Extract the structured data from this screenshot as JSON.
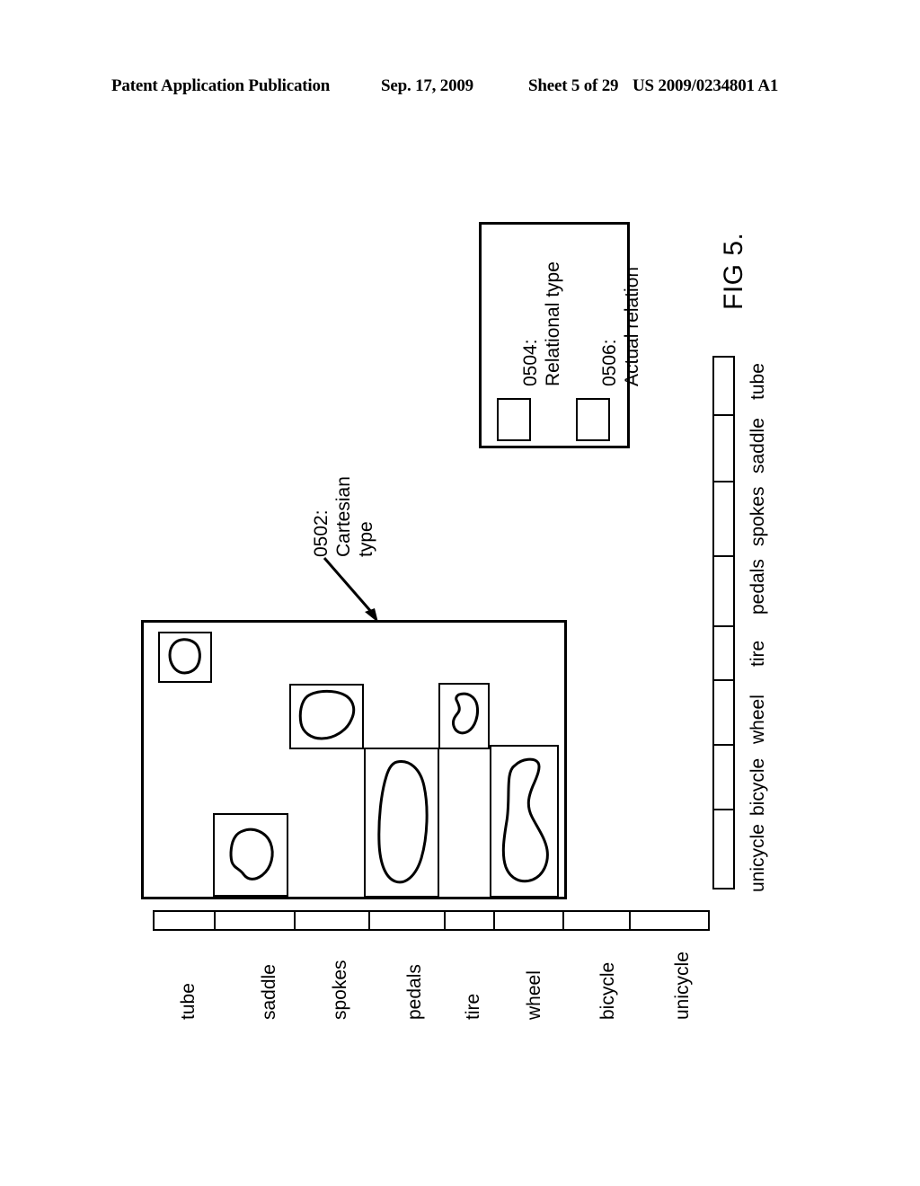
{
  "header": {
    "publication": "Patent Application Publication",
    "date": "Sep. 17, 2009",
    "sheet": "Sheet 5 of 29",
    "number": "US 2009/0234801 A1"
  },
  "figure": {
    "caption": "FIG 5.",
    "annotation_0502": {
      "ref": "0502:",
      "line1": "Cartesian",
      "line2": "type"
    },
    "legend": {
      "items": [
        {
          "ref": "0504:",
          "label": "Relational type"
        },
        {
          "ref": "0506:",
          "label": "Actual relation"
        }
      ]
    },
    "axis_bottom": {
      "labels": [
        "tube",
        "saddle",
        "spokes",
        "pedals",
        "tire",
        "wheel",
        "bicycle",
        "unicycle"
      ]
    },
    "axis_right": {
      "labels": [
        "tube",
        "saddle",
        "spokes",
        "pedals",
        "tire",
        "wheel",
        "bicycle",
        "unicycle"
      ]
    }
  },
  "colors": {
    "ink": "#000000",
    "paper": "#ffffff"
  }
}
